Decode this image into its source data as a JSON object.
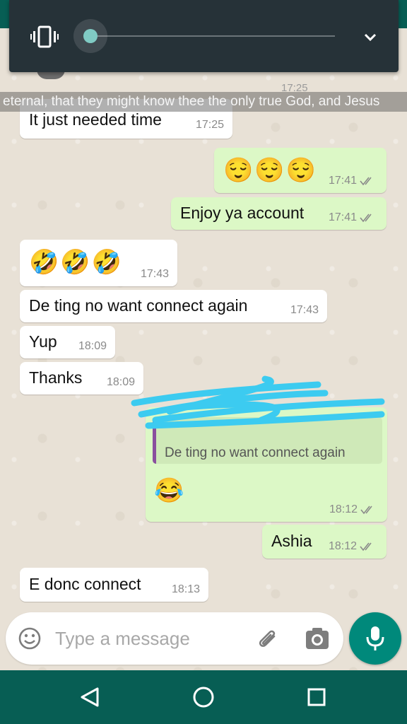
{
  "colors": {
    "incoming_bubble": "#ffffff",
    "outgoing_bubble": "#dcf8c6",
    "teal_dark": "#075e54",
    "mic_button": "#00897b",
    "volume_panel": "#263238",
    "slider_thumb": "#80cbc4",
    "reply_quote_bar": "#8a4f9e",
    "redaction_scribble": "#3ccbf0"
  },
  "volume_panel": {
    "mode_icon": "vibrate-icon",
    "level": 0,
    "collapse_icon": "chevron-down-icon"
  },
  "notification": {
    "marquee_text": "eternal, that they might know thee the only true God, and Jesus"
  },
  "header_peek": {
    "time": "17:25"
  },
  "messages": [
    {
      "dir": "in",
      "text": "It just needed time",
      "time": "17:25"
    },
    {
      "dir": "out",
      "text": "😌😌😌",
      "time": "17:41",
      "status": "read"
    },
    {
      "dir": "out",
      "text": "Enjoy ya account",
      "time": "17:41",
      "status": "read"
    },
    {
      "dir": "in",
      "text": "🤣🤣🤣",
      "time": "17:43"
    },
    {
      "dir": "in",
      "text": "De ting no want connect again",
      "time": "17:43"
    },
    {
      "dir": "in",
      "text": "Yup",
      "time": "18:09"
    },
    {
      "dir": "in",
      "text": "Thanks",
      "time": "18:09"
    },
    {
      "dir": "out",
      "quoted_text": "De ting no want connect again",
      "text": "😂",
      "time": "18:12",
      "status": "read"
    },
    {
      "dir": "out",
      "text": "Ashia",
      "time": "18:12",
      "status": "read"
    },
    {
      "dir": "in",
      "text": "E donc connect",
      "time": "18:13"
    }
  ],
  "composer": {
    "emoji_icon": "emoji-icon",
    "placeholder": "Type a message",
    "attach_icon": "paperclip-icon",
    "camera_icon": "camera-icon",
    "mic_icon": "microphone-icon"
  },
  "nav": {
    "back_icon": "back-triangle-icon",
    "home_icon": "home-circle-icon",
    "recents_icon": "recents-square-icon"
  }
}
